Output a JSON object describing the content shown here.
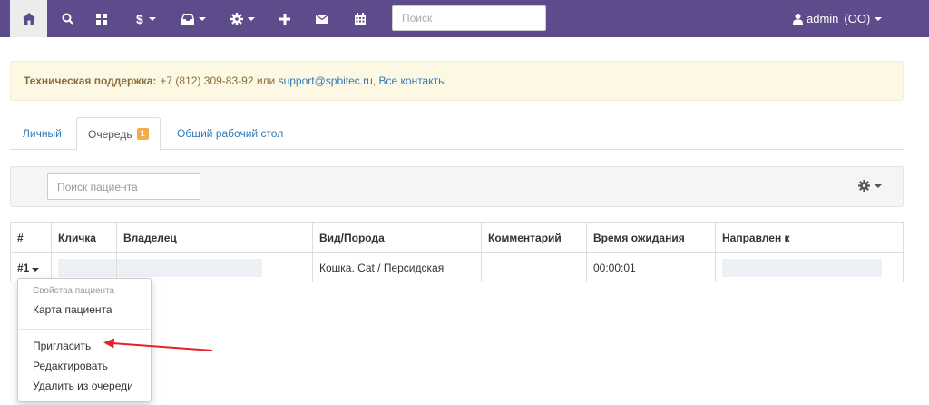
{
  "navbar": {
    "search_placeholder": "Поиск",
    "user_name": "admin",
    "user_org": "(OO)"
  },
  "alert": {
    "label": "Техническая поддержка:",
    "phone_text": "+7 (812) 309-83-92 или",
    "email": "support@spbitec.ru",
    "separator": ",",
    "contacts_link": "Все контакты"
  },
  "tabs": [
    {
      "label": "Личный"
    },
    {
      "label": "Очередь",
      "badge": "1"
    },
    {
      "label": "Общий рабочий стол"
    }
  ],
  "filter": {
    "patient_search_placeholder": "Поиск пациента"
  },
  "table": {
    "headers": [
      "#",
      "Кличка",
      "Владелец",
      "Вид/Порода",
      "Комментарий",
      "Время ожидания",
      "Направлен к"
    ],
    "rows": [
      {
        "num": "#1",
        "species": "Кошка. Cat / Персидская",
        "comment": "",
        "wait_time": "00:00:01"
      }
    ]
  },
  "dropdown": {
    "header": "Свойства пациента",
    "items": [
      "Карта пациента",
      "Пригласить",
      "Редактировать",
      "Удалить из очереди"
    ]
  },
  "colors": {
    "navbar": "#5e4b8b",
    "alert_bg": "#fcf8e3",
    "alert_text": "#8a6d3b",
    "link": "#337ab7",
    "badge": "#f0ad4e",
    "arrow": "#e8202a"
  },
  "icons": [
    "home-icon",
    "search-icon",
    "dashboard-icon",
    "dollar-icon",
    "inbox-icon",
    "gear-icon",
    "plus-icon",
    "envelope-icon",
    "calendar-icon",
    "user-icon"
  ]
}
